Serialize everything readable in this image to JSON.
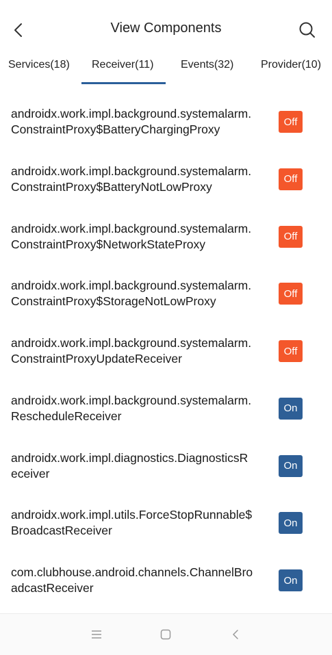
{
  "header": {
    "title": "View Components",
    "back_icon": "back-arrow-icon",
    "search_icon": "search-icon"
  },
  "tabs": [
    {
      "label": "Services(18)",
      "active": false
    },
    {
      "label": "Receiver(11)",
      "active": true
    },
    {
      "label": "Events(32)",
      "active": false
    },
    {
      "label": "Provider(10)",
      "active": false
    }
  ],
  "colors": {
    "off": "#f4572b",
    "on": "#2e5f96",
    "tab_underline": "#2b5f9a"
  },
  "components": [
    {
      "line1": "androidx.work.impl.background.systemalarm.",
      "line2": "ConstraintProxy$BatteryChargingProxy",
      "state": "Off"
    },
    {
      "line1": "androidx.work.impl.background.systemalarm.",
      "line2": "ConstraintProxy$BatteryNotLowProxy",
      "state": "Off"
    },
    {
      "line1": "androidx.work.impl.background.systemalarm.",
      "line2": "ConstraintProxy$NetworkStateProxy",
      "state": "Off"
    },
    {
      "line1": "androidx.work.impl.background.systemalarm.",
      "line2": "ConstraintProxy$StorageNotLowProxy",
      "state": "Off"
    },
    {
      "line1": "androidx.work.impl.background.systemalarm.",
      "line2": "ConstraintProxyUpdateReceiver",
      "state": "Off"
    },
    {
      "line1": "androidx.work.impl.background.systemalarm.",
      "line2": "RescheduleReceiver",
      "state": "On"
    },
    {
      "line1": "androidx.work.impl.diagnostics.DiagnosticsR",
      "line2": "eceiver",
      "state": "On"
    },
    {
      "line1": "androidx.work.impl.utils.ForceStopRunnable$",
      "line2": "BroadcastReceiver",
      "state": "On"
    },
    {
      "line1": "com.clubhouse.android.channels.ChannelBro",
      "line2": "adcastReceiver",
      "state": "On"
    }
  ],
  "navbar": {
    "items": [
      "menu-icon",
      "home-icon",
      "back-icon"
    ]
  }
}
